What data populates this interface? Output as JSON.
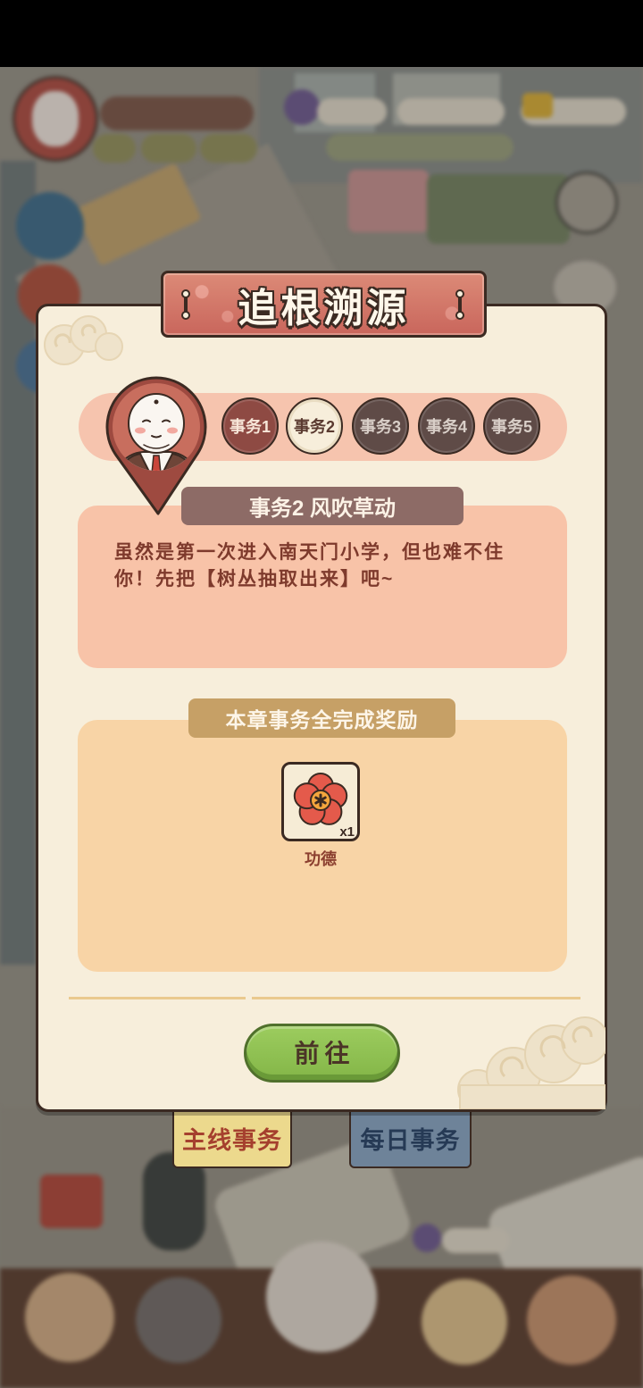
{
  "dialog": {
    "title": "追根溯源",
    "tabs": [
      {
        "label": "事务1",
        "selected": false,
        "bg_color": "#8e4a43",
        "text_color": "#f7e6d8"
      },
      {
        "label": "事务2",
        "selected": true,
        "bg_color": "#f7eedb",
        "text_color": "#5a3a30"
      },
      {
        "label": "事务3",
        "selected": false,
        "bg_color": "#5f4b47",
        "text_color": "#d9cfc8"
      },
      {
        "label": "事务4",
        "selected": false,
        "bg_color": "#5f4b47",
        "text_color": "#d9cfc8"
      },
      {
        "label": "事务5",
        "selected": false,
        "bg_color": "#5f4b47",
        "text_color": "#d9cfc8"
      }
    ],
    "task": {
      "heading": "事务2 风吹草动",
      "description_lines": [
        "虽然是第一次进入南天门小学，但也难不住",
        "你！先把【树丛抽取出来】吧~"
      ]
    },
    "reward_section": {
      "heading": "本章事务全完成奖励",
      "items": [
        {
          "name": "功德",
          "quantity": "x1",
          "icon": "merit-flower-icon"
        }
      ]
    },
    "go_button_label": "前往"
  },
  "bottom_tabs": [
    {
      "label": "主线事务",
      "selected": true,
      "bg_color": "#ecd98d",
      "text_color": "#a5402e"
    },
    {
      "label": "每日事务",
      "selected": false,
      "bg_color": "#6e8399",
      "text_color": "#263a55"
    }
  ],
  "theme": {
    "panel_bg": "#f7eedb",
    "outline": "#3b2a22",
    "title_banner": "#c9665c",
    "task_box": "#f8c3a8",
    "reward_box": "#f8d4a6",
    "go_button": "#84b648"
  }
}
